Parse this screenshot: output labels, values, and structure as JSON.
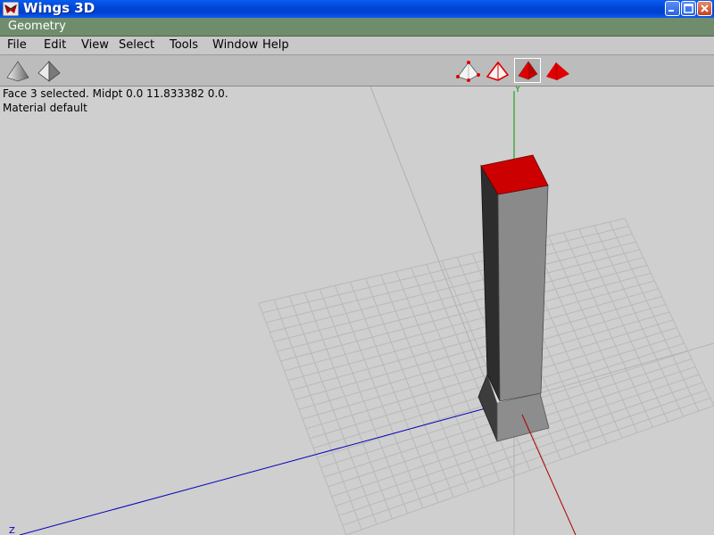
{
  "window": {
    "title": "Wings 3D"
  },
  "geometry_window": {
    "title": "Geometry"
  },
  "menu": {
    "items": [
      "File",
      "Edit",
      "View",
      "Select",
      "Tools",
      "Window",
      "Help"
    ]
  },
  "toolbar": {
    "left_icons": [
      "smooth-shade-icon",
      "flat-shade-icon"
    ],
    "select_modes": [
      "vertex-mode-icon",
      "edge-mode-icon",
      "face-mode-icon",
      "body-mode-icon"
    ],
    "active_mode": "face-mode-icon"
  },
  "viewport": {
    "info": {
      "line1": "Face 3 selected. Midpt 0.0 11.833382 0.0.",
      "line2": "Material default"
    },
    "axes": {
      "y_label": "Y",
      "z_label": "Z"
    },
    "colors": {
      "background": "#cfcfcf",
      "grid": "#b8b8b8",
      "selected_face": "#cc0000",
      "x_axis": "#aa0000",
      "y_axis": "#009900",
      "z_axis": "#0000bb"
    }
  }
}
